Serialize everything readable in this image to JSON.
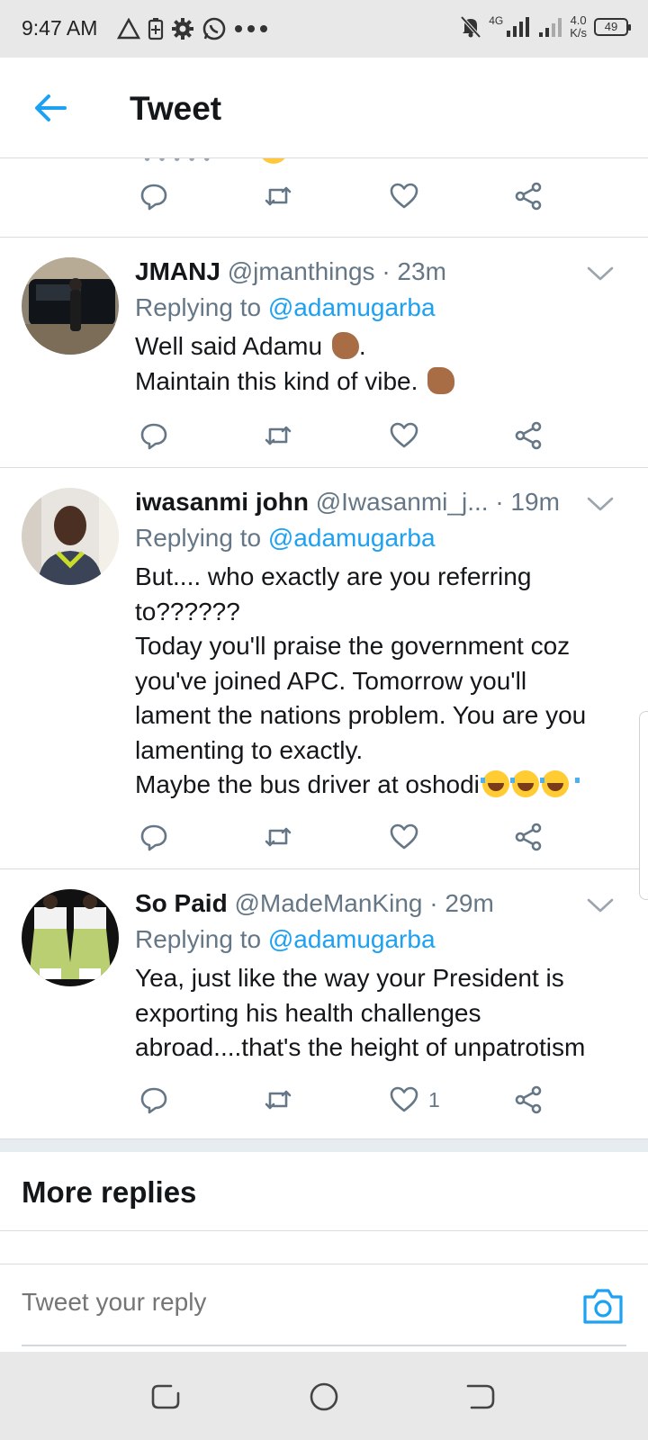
{
  "status_bar": {
    "time": "9:47 AM",
    "network": "4G",
    "speed_value": "4.0",
    "speed_unit": "K/s",
    "battery": "49"
  },
  "header": {
    "title": "Tweet"
  },
  "tweets": [
    {
      "name": "JMANJ",
      "handle": "@jmanthings",
      "time": "· 23m",
      "replying_prefix": "Replying to",
      "replying_to": "@adamugarba",
      "lines": [
        "Well said Adamu",
        ".",
        "Maintain this kind of vibe."
      ],
      "like_count": ""
    },
    {
      "name": "iwasanmi john",
      "handle": "@Iwasanmi_j...",
      "time": "· 19m",
      "replying_prefix": "Replying to",
      "replying_to": "@adamugarba",
      "lines": [
        "But.... who exactly  are you referring",
        "to??????",
        "Today  you'll praise  the government  coz",
        "you've joined  APC. Tomorrow  you'll",
        "lament the nations problem.  You are you",
        "lamenting  to exactly.",
        "Maybe  the bus driver at oshodi"
      ],
      "like_count": ""
    },
    {
      "name": "So Paid",
      "handle": "@MadeManKing",
      "time": "· 29m",
      "replying_prefix": "Replying to",
      "replying_to": "@adamugarba",
      "lines": [
        "Yea, just like the way your President is",
        "exporting his health challenges",
        "abroad....that's the height of unpatrotism"
      ],
      "like_count": "1"
    }
  ],
  "more_replies": {
    "title": "More replies"
  },
  "composer": {
    "placeholder": "Tweet your reply"
  },
  "colors": {
    "accent": "#1da1f2",
    "secondary_text": "#657786",
    "divider": "#d9dde1"
  },
  "icons": {
    "back": "arrow-left-icon",
    "reply": "reply-icon",
    "retweet": "retweet-icon",
    "like": "heart-icon",
    "share": "share-icon",
    "caret": "chevron-down-icon",
    "camera": "camera-icon"
  }
}
